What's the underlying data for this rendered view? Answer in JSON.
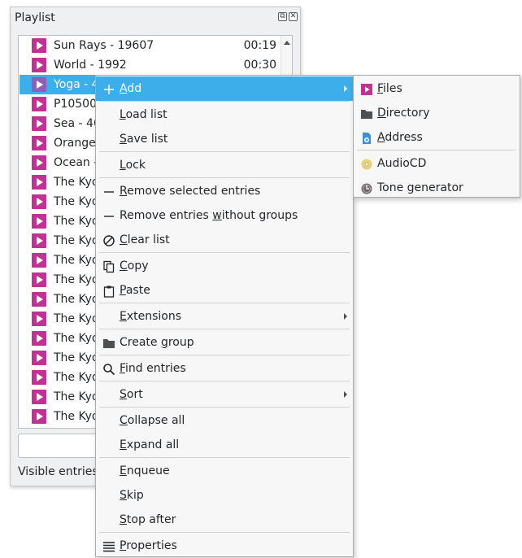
{
  "dock": {
    "title": "Playlist",
    "float_btn": "⧉",
    "close_btn": "✕",
    "status_text": "Visible entries",
    "rows": [
      {
        "title": "Sun Rays - 19607",
        "time": "00:19",
        "selected": false
      },
      {
        "title": "World - 1992",
        "time": "00:30",
        "selected": false
      },
      {
        "title": "Yoga - 4",
        "time": "",
        "selected": true
      },
      {
        "title": "P10500",
        "time": "",
        "selected": false
      },
      {
        "title": "Sea - 40",
        "time": "",
        "selected": false
      },
      {
        "title": "Orange",
        "time": "",
        "selected": false
      },
      {
        "title": "Ocean -",
        "time": "",
        "selected": false
      },
      {
        "title": "The Kyo",
        "time": "",
        "selected": false
      },
      {
        "title": "The Kyo",
        "time": "",
        "selected": false
      },
      {
        "title": "The Kyo",
        "time": "",
        "selected": false
      },
      {
        "title": "The Kyo",
        "time": "",
        "selected": false
      },
      {
        "title": "The Kyo",
        "time": "",
        "selected": false
      },
      {
        "title": "The Kyo",
        "time": "",
        "selected": false
      },
      {
        "title": "The Kyo",
        "time": "",
        "selected": false
      },
      {
        "title": "The Kyo",
        "time": "",
        "selected": false
      },
      {
        "title": "The Kyo",
        "time": "",
        "selected": false
      },
      {
        "title": "The Kyo",
        "time": "",
        "selected": false
      },
      {
        "title": "The Kyo",
        "time": "",
        "selected": false
      },
      {
        "title": "The Kyo",
        "time": "",
        "selected": false
      },
      {
        "title": "The Kyo",
        "time": "",
        "selected": false
      }
    ]
  },
  "context_menu": {
    "items": {
      "add": {
        "pre": "",
        "u": "A",
        "post": "dd",
        "icon": "plus-icon"
      },
      "load_list": {
        "pre": "",
        "u": "L",
        "post": "oad list"
      },
      "save_list": {
        "pre": "",
        "u": "S",
        "post": "ave list"
      },
      "lock": {
        "pre": "",
        "u": "L",
        "post": "ock"
      },
      "remove_selected": {
        "pre": "",
        "u": "R",
        "post": "emove selected entries",
        "icon": "minus-icon"
      },
      "remove_without_groups": {
        "pre": "Remove entries ",
        "u": "w",
        "post": "ithout groups",
        "icon": "minus-icon"
      },
      "clear_list": {
        "pre": "",
        "u": "C",
        "post": "lear list",
        "icon": "clear-icon"
      },
      "copy": {
        "pre": "",
        "u": "C",
        "post": "opy",
        "icon": "copy-icon"
      },
      "paste": {
        "pre": "",
        "u": "P",
        "post": "aste",
        "icon": "paste-icon"
      },
      "extensions": {
        "pre": "",
        "u": "E",
        "post": "xtensions"
      },
      "create_group": {
        "pre": "Create ",
        "u": "g",
        "post": "roup",
        "icon": "folder-icon"
      },
      "find_entries": {
        "pre": "",
        "u": "F",
        "post": "ind entries",
        "icon": "search-icon"
      },
      "sort": {
        "pre": "",
        "u": "S",
        "post": "ort"
      },
      "collapse_all": {
        "pre": "",
        "u": "C",
        "post": "ollapse all"
      },
      "expand_all": {
        "pre": "",
        "u": "E",
        "post": "xpand all"
      },
      "enqueue": {
        "pre": "",
        "u": "E",
        "post": "nqueue"
      },
      "skip": {
        "pre": "",
        "u": "S",
        "post": "kip"
      },
      "stop_after": {
        "pre": "",
        "u": "S",
        "post": "top after"
      },
      "properties": {
        "pre": "",
        "u": "P",
        "post": "roperties",
        "icon": "list-icon"
      }
    }
  },
  "submenu": {
    "items": {
      "files": {
        "pre": "",
        "u": "F",
        "post": "iles",
        "icon": "play-file-icon"
      },
      "directory": {
        "pre": "",
        "u": "D",
        "post": "irectory",
        "icon": "folder-icon"
      },
      "address": {
        "pre": "",
        "u": "A",
        "post": "ddress",
        "icon": "network-file-icon"
      },
      "audiocd": {
        "pre": "AudioCD",
        "u": "",
        "post": "",
        "icon": "cd-icon"
      },
      "tone_generator": {
        "pre": "Tone generator",
        "u": "",
        "post": "",
        "icon": "tone-icon"
      }
    }
  },
  "colors": {
    "selection": "#3daee9",
    "play_icon": "#c03394"
  }
}
